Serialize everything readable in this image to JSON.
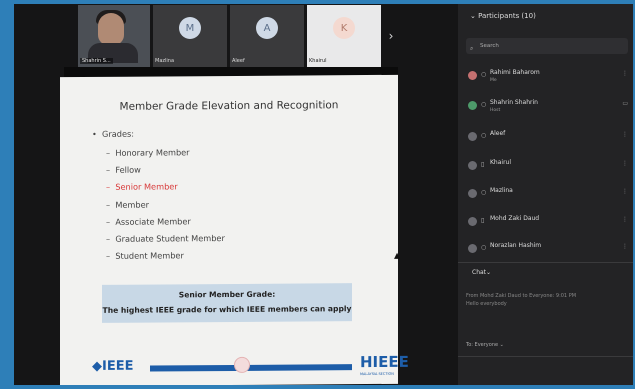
{
  "thumbnails": [
    {
      "name": "Shahrin S...",
      "kind": "video"
    },
    {
      "name": "Mazlina",
      "initial": "M",
      "kind": "avatar"
    },
    {
      "name": "Aleef",
      "initial": "A",
      "kind": "avatar"
    },
    {
      "name": "Khairul",
      "initial": "K",
      "kind": "white"
    }
  ],
  "next_icon": "chevron-right-icon",
  "slide": {
    "title": "Member Grade Elevation and Recognition",
    "bullet_head": "Grades:",
    "grades": [
      "Honorary Member",
      "Fellow",
      "Senior Member",
      "Member",
      "Associate Member",
      "Graduate Student Member",
      "Student Member"
    ],
    "highlight": "Senior Member",
    "callout_title": "Senior Member Grade:",
    "callout_text": "The highest IEEE grade for which IEEE members can apply",
    "logo_left": "◆IEEE",
    "logo_right": "HIEEE",
    "logo_sub": "MALAYSIA SECTION",
    "highlight_color": "#d83a3a"
  },
  "participants": {
    "title": "Participants (10)",
    "search_placeholder": "Search",
    "list": [
      {
        "name": "Rahimi Baharom",
        "sub": "Me"
      },
      {
        "name": "Shahrin Shahrin",
        "sub": "Host"
      },
      {
        "name": "Aleef",
        "sub": ""
      },
      {
        "name": "Khairul",
        "sub": ""
      },
      {
        "name": "Mazlina",
        "sub": ""
      },
      {
        "name": "Mohd Zaki Daud",
        "sub": ""
      },
      {
        "name": "Norazlan Hashim",
        "sub": ""
      }
    ]
  },
  "chat": {
    "title": "Chat",
    "message": "From Mohd Zaki Daud to Everyone: 9:01 PM",
    "message_body": "Hello everybody",
    "to_label": "Everyone"
  }
}
